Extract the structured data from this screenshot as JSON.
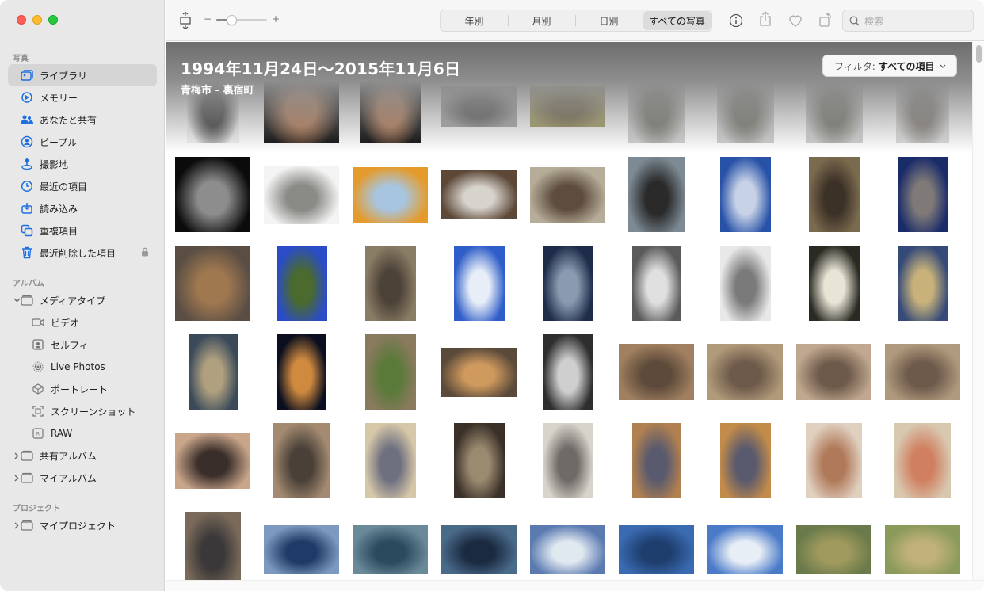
{
  "sidebar": {
    "sections": {
      "photos": "写真",
      "albums": "アルバム",
      "projects": "プロジェクト"
    },
    "library_items": [
      {
        "label": "ライブラリ",
        "icon": "photo-library-icon",
        "selected": true
      },
      {
        "label": "メモリー",
        "icon": "memories-icon"
      },
      {
        "label": "あなたと共有",
        "icon": "shared-with-you-icon"
      },
      {
        "label": "ピープル",
        "icon": "people-icon"
      },
      {
        "label": "撮影地",
        "icon": "places-icon"
      },
      {
        "label": "最近の項目",
        "icon": "recents-icon"
      },
      {
        "label": "読み込み",
        "icon": "imports-icon"
      },
      {
        "label": "重複項目",
        "icon": "duplicates-icon"
      },
      {
        "label": "最近削除した項目",
        "icon": "recently-deleted-icon",
        "locked": true
      }
    ],
    "album_items": [
      {
        "label": "メディアタイプ",
        "icon": "folder-icon",
        "expanded": true
      },
      {
        "label": "ビデオ",
        "icon": "video-icon",
        "sub": true
      },
      {
        "label": "セルフィー",
        "icon": "selfie-icon",
        "sub": true
      },
      {
        "label": "Live Photos",
        "icon": "live-photos-icon",
        "sub": true
      },
      {
        "label": "ポートレート",
        "icon": "portrait-icon",
        "sub": true
      },
      {
        "label": "スクリーンショット",
        "icon": "screenshot-icon",
        "sub": true
      },
      {
        "label": "RAW",
        "icon": "raw-icon",
        "sub": true
      },
      {
        "label": "共有アルバム",
        "icon": "folder-icon",
        "collapsed": true
      },
      {
        "label": "マイアルバム",
        "icon": "folder-icon",
        "collapsed": true
      }
    ],
    "project_items": [
      {
        "label": "マイプロジェクト",
        "icon": "folder-icon",
        "collapsed": true
      }
    ]
  },
  "toolbar": {
    "zoom_minus": "−",
    "zoom_plus": "+",
    "zoom_level": 0.3,
    "segments": [
      {
        "label": "年別"
      },
      {
        "label": "月別"
      },
      {
        "label": "日別"
      },
      {
        "label": "すべての写真",
        "active": true
      }
    ],
    "search_placeholder": "検索"
  },
  "content": {
    "date_range": "1994年11月24日〜2015年11月6日",
    "location": "青梅市 - 裏宿町",
    "filter_label": "フィルタ:",
    "filter_value": "すべての項目"
  },
  "photos": [
    {
      "desc": "bearded man mask",
      "colors": [
        "#f1f1f1",
        "#3c3c3c"
      ]
    },
    {
      "desc": "man face dark",
      "colors": [
        "#0a0a0a",
        "#b47a54"
      ]
    },
    {
      "desc": "man face dark",
      "colors": [
        "#0a0a0a",
        "#b47a54"
      ]
    },
    {
      "desc": "cat on couch",
      "colors": [
        "#a5a5a5",
        "#5a5a5a"
      ]
    },
    {
      "desc": "two cats",
      "colors": [
        "#a19a5e",
        "#6e6240"
      ]
    },
    {
      "desc": "cats",
      "colors": [
        "#cfcfcf",
        "#7a7a70"
      ]
    },
    {
      "desc": "cats",
      "colors": [
        "#cfcfcf",
        "#7a7a70"
      ]
    },
    {
      "desc": "cats",
      "colors": [
        "#cfcfcf",
        "#7a7a70"
      ]
    },
    {
      "desc": "cats",
      "colors": [
        "#dadada",
        "#86807a"
      ]
    },
    {
      "desc": "cats black bg",
      "colors": [
        "#0b0b0b",
        "#8d8d8d"
      ]
    },
    {
      "desc": "cats white bg",
      "colors": [
        "#f4f4f4",
        "#8a8a86"
      ]
    },
    {
      "desc": "toy",
      "colors": [
        "#e49b2c",
        "#a7c5e0"
      ]
    },
    {
      "desc": "cat on chair",
      "colors": [
        "#5d4837",
        "#d7d3cd"
      ]
    },
    {
      "desc": "man in room",
      "colors": [
        "#b6ad98",
        "#5e4c3e"
      ]
    },
    {
      "desc": "tree sky",
      "colors": [
        "#7d8a94",
        "#2a2a2a"
      ]
    },
    {
      "desc": "blue sky",
      "colors": [
        "#2852a8",
        "#c7d2e6"
      ]
    },
    {
      "desc": "bicycle",
      "colors": [
        "#7a6a4e",
        "#3c3126"
      ]
    },
    {
      "desc": "tree night sky",
      "colors": [
        "#1a2b6a",
        "#7f7a78"
      ]
    },
    {
      "desc": "leaves",
      "colors": [
        "#5a4e44",
        "#a07850"
      ]
    },
    {
      "desc": "blue sky field",
      "colors": [
        "#2a4cc8",
        "#4a6a2e"
      ]
    },
    {
      "desc": "bike wheel",
      "colors": [
        "#8a7d65",
        "#4c4238"
      ]
    },
    {
      "desc": "clouds",
      "colors": [
        "#2f5ec8",
        "#e8eef8"
      ]
    },
    {
      "desc": "dark tree",
      "colors": [
        "#1e2c4a",
        "#8a9ab0"
      ]
    },
    {
      "desc": "cup",
      "colors": [
        "#5a5a5a",
        "#e0e0e0"
      ]
    },
    {
      "desc": "cat sleeping",
      "colors": [
        "#e8e8e8",
        "#7a7a7a"
      ]
    },
    {
      "desc": "cup light",
      "colors": [
        "#2a2a22",
        "#e8e4d6"
      ]
    },
    {
      "desc": "dusk sky",
      "colors": [
        "#354a78",
        "#c8b27a"
      ]
    },
    {
      "desc": "window",
      "colors": [
        "#3a4a5a",
        "#b0a080"
      ]
    },
    {
      "desc": "sunset",
      "colors": [
        "#0a0e1e",
        "#d08a40"
      ]
    },
    {
      "desc": "bush",
      "colors": [
        "#8a7a5e",
        "#5a7a3a"
      ]
    },
    {
      "desc": "orange cat",
      "colors": [
        "#5a4a3a",
        "#d09a5e"
      ]
    },
    {
      "desc": "device",
      "colors": [
        "#2e2e2e",
        "#cfcfcf"
      ]
    },
    {
      "desc": "cat close",
      "colors": [
        "#a08060",
        "#5e4a3a"
      ]
    },
    {
      "desc": "cat close",
      "colors": [
        "#b09a7a",
        "#6e5a4a"
      ]
    },
    {
      "desc": "cat face",
      "colors": [
        "#c0a890",
        "#6e5a4a"
      ]
    },
    {
      "desc": "cat face",
      "colors": [
        "#b09a7e",
        "#6e5a4a"
      ]
    },
    {
      "desc": "man face",
      "colors": [
        "#c9a58a",
        "#3a2e2a"
      ]
    },
    {
      "desc": "man bookshelf",
      "colors": [
        "#a38a70",
        "#4a4038"
      ]
    },
    {
      "desc": "grey cat",
      "colors": [
        "#d6c7a8",
        "#6e7080"
      ]
    },
    {
      "desc": "cat",
      "colors": [
        "#3a3028",
        "#9a8a70"
      ]
    },
    {
      "desc": "cat on chair",
      "colors": [
        "#d8d4cc",
        "#6e6a66"
      ]
    },
    {
      "desc": "cat floor",
      "colors": [
        "#b08050",
        "#5a5a6e"
      ]
    },
    {
      "desc": "grey cat",
      "colors": [
        "#c28b4a",
        "#5a5a6e"
      ]
    },
    {
      "desc": "man with bottle",
      "colors": [
        "#e0d0c0",
        "#b07a5a"
      ]
    },
    {
      "desc": "man bookshelf",
      "colors": [
        "#d8c8b0",
        "#d08060"
      ]
    },
    {
      "desc": "man face",
      "colors": [
        "#7a6a5a",
        "#3a3838"
      ]
    },
    {
      "desc": "lake",
      "colors": [
        "#7c9ac0",
        "#1e3a66"
      ]
    },
    {
      "desc": "lake boat",
      "colors": [
        "#6a8a9a",
        "#2a4a5e"
      ]
    },
    {
      "desc": "lake dark",
      "colors": [
        "#4a6a8a",
        "#1a2a40"
      ]
    },
    {
      "desc": "lake sun",
      "colors": [
        "#5a7ab0",
        "#e0e8f0"
      ]
    },
    {
      "desc": "mount fuji lake",
      "colors": [
        "#3a6ab0",
        "#1e3e6e"
      ]
    },
    {
      "desc": "mount fuji",
      "colors": [
        "#4a7ac8",
        "#e8eef6"
      ]
    },
    {
      "desc": "reeds",
      "colors": [
        "#6a7a4a",
        "#a09a5e"
      ]
    },
    {
      "desc": "reeds",
      "colors": [
        "#8a9a5a",
        "#c0b07a"
      ]
    }
  ]
}
